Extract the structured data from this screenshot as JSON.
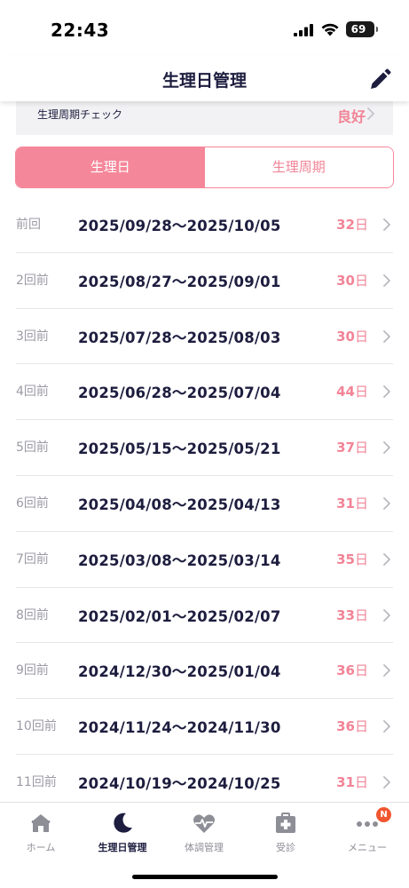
{
  "status_bar": {
    "time": "22:43",
    "battery": "69"
  },
  "header": {
    "title": "生理日管理",
    "edit_icon": "pencil-icon"
  },
  "cycle_check": {
    "label": "生理周期チェック",
    "value": "良好"
  },
  "segments": {
    "active": "生理日",
    "inactive": "生理周期"
  },
  "periods": [
    {
      "label": "前回",
      "range": "2025/09/28〜2025/10/05",
      "days": "32",
      "unit": "日"
    },
    {
      "label": "2回前",
      "range": "2025/08/27〜2025/09/01",
      "days": "30",
      "unit": "日"
    },
    {
      "label": "3回前",
      "range": "2025/07/28〜2025/08/03",
      "days": "30",
      "unit": "日"
    },
    {
      "label": "4回前",
      "range": "2025/06/28〜2025/07/04",
      "days": "44",
      "unit": "日"
    },
    {
      "label": "5回前",
      "range": "2025/05/15〜2025/05/21",
      "days": "37",
      "unit": "日"
    },
    {
      "label": "6回前",
      "range": "2025/04/08〜2025/04/13",
      "days": "31",
      "unit": "日"
    },
    {
      "label": "7回前",
      "range": "2025/03/08〜2025/03/14",
      "days": "35",
      "unit": "日"
    },
    {
      "label": "8回前",
      "range": "2025/02/01〜2025/02/07",
      "days": "33",
      "unit": "日"
    },
    {
      "label": "9回前",
      "range": "2024/12/30〜2025/01/04",
      "days": "36",
      "unit": "日"
    },
    {
      "label": "10回前",
      "range": "2024/11/24〜2024/11/30",
      "days": "36",
      "unit": "日"
    },
    {
      "label": "11回前",
      "range": "2024/10/19〜2024/10/25",
      "days": "31",
      "unit": "日"
    }
  ],
  "tab_bar": {
    "home": "ホーム",
    "period": "生理日管理",
    "condition": "体調管理",
    "consult": "受診",
    "menu": "メニュー",
    "menu_badge": "N"
  },
  "colors": {
    "accent": "#f5879a",
    "text_dark": "#1d1d3f",
    "badge": "#f0562f"
  }
}
